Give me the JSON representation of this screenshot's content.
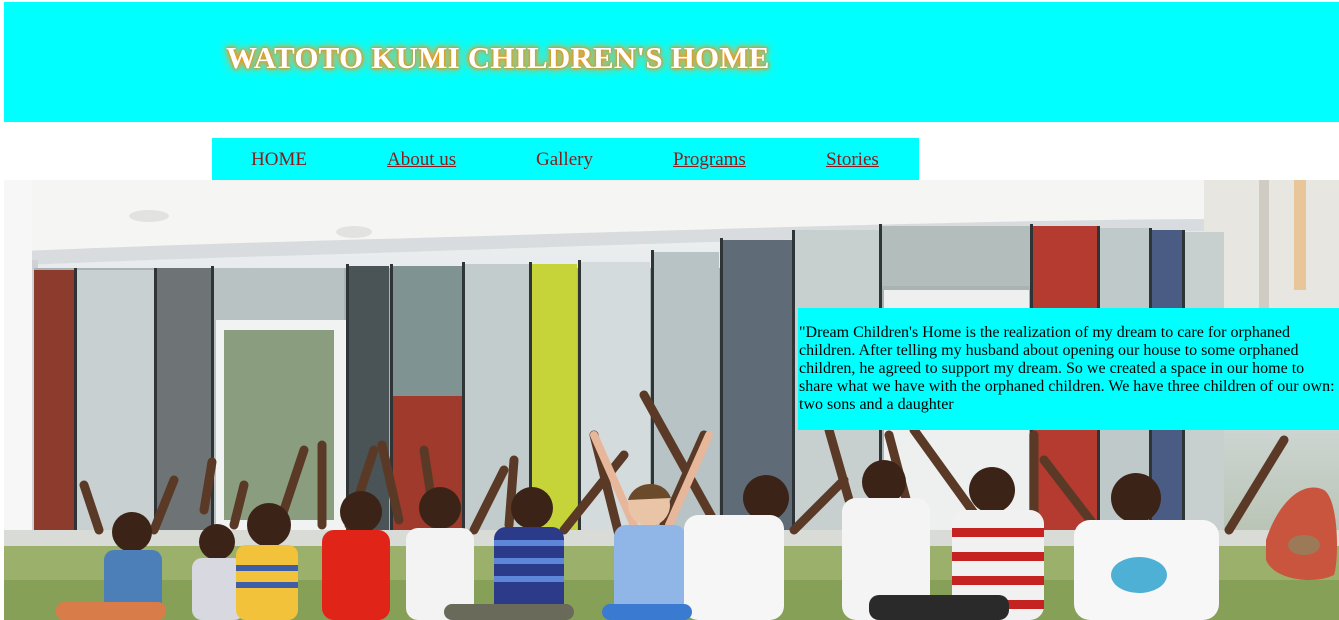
{
  "header": {
    "title": "WATOTO KUMI CHILDREN'S HOME",
    "background_color": "#00ffff",
    "title_color": "#ffffff",
    "title_glow_color": "#ff8a00"
  },
  "nav": {
    "background_color": "#00ffff",
    "link_color": "#8b1a1a",
    "items": [
      {
        "label": "HOME",
        "underlined": false
      },
      {
        "label": "About us",
        "underlined": true
      },
      {
        "label": "Gallery",
        "underlined": false
      },
      {
        "label": "Programs",
        "underlined": true
      },
      {
        "label": "Stories",
        "underlined": true
      }
    ]
  },
  "hero": {
    "image_description_icon": "children-photo",
    "quote": "\"Dream Children's Home is the realization of my dream to care for orphaned children. After telling my husband about opening our house to some orphaned children, he agreed to support my dream. So we created a space in our home to share what we have with the orphaned children. We have three children of our own: two sons and a daughter"
  }
}
